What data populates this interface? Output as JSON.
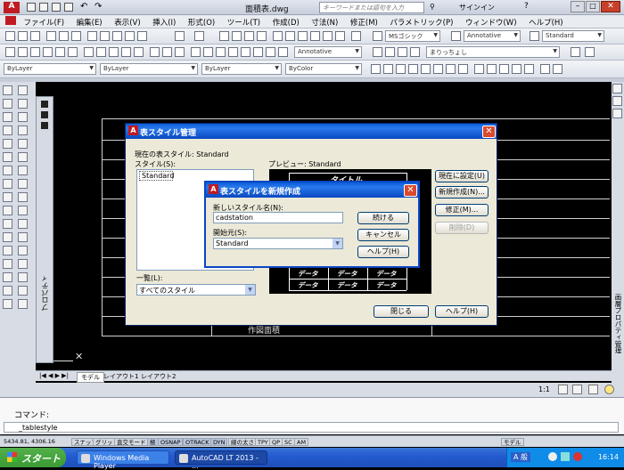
{
  "titlebar": {
    "title": "面積表.dwg",
    "search_placeholder": "キーワードまたは語句を入力",
    "signin": "サインイン"
  },
  "menu": {
    "items": [
      "ファイル(F)",
      "編集(E)",
      "表示(V)",
      "挿入(I)",
      "形式(O)",
      "ツール(T)",
      "作成(D)",
      "寸法(N)",
      "修正(M)",
      "パラメトリック(P)",
      "ウィンドウ(W)",
      "ヘルプ(H)"
    ]
  },
  "toolbars": {
    "textstyle": "MSゴシック",
    "annot1": "Annotative",
    "style3": "Standard",
    "annot2": "Annotative",
    "dimstyle": "まりっちょし",
    "layer": "ByLayer",
    "linetype": "ByLayer",
    "lineweight": "ByLayer",
    "color": "ByColor"
  },
  "main_dialog": {
    "title": "表スタイル管理",
    "current_style": "現在の表スタイル: Standard",
    "styles_label": "スタイル(S):",
    "styles": [
      "Standard"
    ],
    "preview_label": "プレビュー: Standard",
    "list_label": "一覧(L):",
    "list_value": "すべてのスタイル",
    "buttons": {
      "set_current": "現在に設定(U)",
      "new": "新規作成(N)...",
      "modify": "修正(M)...",
      "delete": "削除(D)",
      "close": "閉じる",
      "help": "ヘルプ(H)"
    },
    "preview": {
      "title": "タイトル",
      "data_cell": "データ"
    }
  },
  "new_dialog": {
    "title": "表スタイルを新規作成",
    "name_label": "新しいスタイル名(N):",
    "name_value": "cadstation",
    "start_label": "開始元(S):",
    "start_value": "Standard",
    "buttons": {
      "continue": "続ける",
      "cancel": "キャンセル",
      "help": "ヘルプ(H)"
    }
  },
  "drawing": {
    "caption": "作図面積"
  },
  "tabs": [
    "モデル",
    "レイアウト1",
    "レイアウト2"
  ],
  "palette": {
    "properties": "プロパティ",
    "right_panel": "画層プロパティ管理"
  },
  "annotation": {
    "scale": "1:1"
  },
  "command": {
    "label": "コマンド:",
    "input": "_tablestyle"
  },
  "status": {
    "coords": "5434.81, 4306.16",
    "toggles": [
      "スナップ",
      "グリッド",
      "直交モード",
      "極",
      "OSNAP",
      "OTRACK",
      "DYN",
      "線の太さ",
      "TPY",
      "QP",
      "SC",
      "AM"
    ],
    "right": "モデル"
  },
  "taskbar": {
    "start": "スタート",
    "tasks": [
      "Windows Media Player",
      "AutoCAD LT 2013 - ..."
    ],
    "time": "16:14",
    "ime": "A 般"
  }
}
